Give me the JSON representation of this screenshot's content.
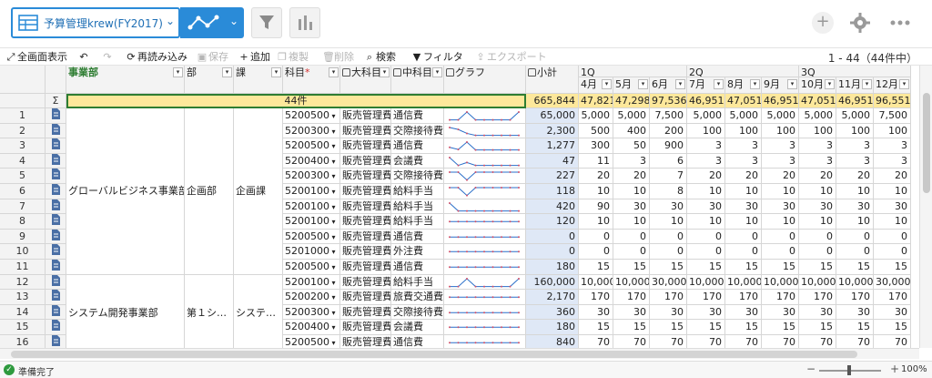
{
  "app": {
    "view_title": "予算管理krew(FY2017)",
    "record_range": "1 - 44（44件中）",
    "status": "準備完了",
    "zoom": "100%",
    "accent": "#2a8bd8"
  },
  "toolbar": [
    {
      "icon": "expand-icon",
      "label": "全画面表示",
      "enabled": true
    },
    {
      "icon": "undo-icon",
      "label": "",
      "enabled": true
    },
    {
      "icon": "redo-icon",
      "label": "",
      "enabled": false
    },
    {
      "icon": "reload-icon",
      "label": "再読み込み",
      "enabled": true
    },
    {
      "icon": "save-icon",
      "label": "保存",
      "enabled": false
    },
    {
      "icon": "plus-icon",
      "label": "追加",
      "enabled": true
    },
    {
      "icon": "copy-icon",
      "label": "複製",
      "enabled": false
    },
    {
      "icon": "trash-icon",
      "label": "削除",
      "enabled": false
    },
    {
      "icon": "search-icon",
      "label": "検索",
      "enabled": true
    },
    {
      "icon": "filter-icon",
      "label": "フィルタ",
      "enabled": true
    },
    {
      "icon": "export-icon",
      "label": "エクスポート",
      "enabled": false
    }
  ],
  "columns": {
    "division": "事業部",
    "department": "部",
    "section": "課",
    "account": "科目",
    "account_required": "*",
    "major": "大科目",
    "minor": "中科目",
    "graph": "グラフ",
    "subtotal": "小計",
    "quarters": [
      "1Q",
      "2Q",
      "3Q"
    ],
    "months": [
      "4月",
      "5月",
      "6月",
      "7月",
      "8月",
      "9月",
      "10月",
      "11月",
      "12月"
    ]
  },
  "summary": {
    "symbol": "Σ",
    "count": "44件",
    "subtotal": "665,844",
    "months": [
      "47,821",
      "47,298",
      "97,536",
      "46,951",
      "47,051",
      "46,951",
      "47,051",
      "46,951",
      "96,551"
    ]
  },
  "groups": [
    {
      "division": "グローバルビジネス事業部",
      "department": "企画部",
      "section": "企画課",
      "rows": 11
    },
    {
      "division": "システム開発事業部",
      "department": "第１シ…",
      "section": "システ…",
      "rows": 5
    }
  ],
  "rows": [
    {
      "n": "1",
      "code": "5200500",
      "major": "販売管理費",
      "minor": "通信費",
      "subtotal": "65,000",
      "m": [
        "5,000",
        "5,000",
        "7,500",
        "5,000",
        "5,000",
        "5,000",
        "5,000",
        "5,000",
        "7,500"
      ],
      "spark": [
        5,
        5,
        7.5,
        5,
        5,
        5,
        5,
        5,
        7.5
      ]
    },
    {
      "n": "2",
      "code": "5200300",
      "major": "販売管理費",
      "minor": "交際接待費",
      "subtotal": "2,300",
      "m": [
        "500",
        "400",
        "200",
        "100",
        "100",
        "100",
        "100",
        "100",
        "100"
      ],
      "spark": [
        5,
        4,
        2,
        1,
        1,
        1,
        1,
        1,
        1
      ]
    },
    {
      "n": "3",
      "code": "5200500",
      "major": "販売管理費",
      "minor": "通信費",
      "subtotal": "1,277",
      "m": [
        "300",
        "50",
        "900",
        "3",
        "3",
        "3",
        "3",
        "3",
        "3"
      ],
      "spark": [
        3,
        0.5,
        9,
        0,
        0,
        0,
        0,
        0,
        0
      ]
    },
    {
      "n": "4",
      "code": "5200400",
      "major": "販売管理費",
      "minor": "会議費",
      "subtotal": "47",
      "m": [
        "11",
        "3",
        "6",
        "3",
        "3",
        "3",
        "3",
        "3",
        "3"
      ],
      "spark": [
        11,
        3,
        6,
        3,
        3,
        3,
        3,
        3,
        3
      ]
    },
    {
      "n": "5",
      "code": "5200300",
      "major": "販売管理費",
      "minor": "交際接待費",
      "subtotal": "227",
      "m": [
        "20",
        "20",
        "7",
        "20",
        "20",
        "20",
        "20",
        "20",
        "20"
      ],
      "spark": [
        20,
        20,
        7,
        20,
        20,
        20,
        20,
        20,
        20
      ]
    },
    {
      "n": "6",
      "code": "5200100",
      "major": "販売管理費",
      "minor": "給料手当",
      "subtotal": "118",
      "m": [
        "10",
        "10",
        "8",
        "10",
        "10",
        "10",
        "10",
        "10",
        "10"
      ],
      "spark": [
        10,
        10,
        8,
        10,
        10,
        10,
        10,
        10,
        10
      ]
    },
    {
      "n": "7",
      "code": "5200100",
      "major": "販売管理費",
      "minor": "給料手当",
      "subtotal": "420",
      "m": [
        "90",
        "30",
        "30",
        "30",
        "30",
        "30",
        "30",
        "30",
        "30"
      ],
      "spark": [
        90,
        30,
        30,
        30,
        30,
        30,
        30,
        30,
        30
      ]
    },
    {
      "n": "8",
      "code": "5200100",
      "major": "販売管理費",
      "minor": "給料手当",
      "subtotal": "120",
      "m": [
        "10",
        "10",
        "10",
        "10",
        "10",
        "10",
        "10",
        "10",
        "10"
      ],
      "spark": [
        10,
        10,
        10,
        10,
        10,
        10,
        10,
        10,
        10
      ]
    },
    {
      "n": "9",
      "code": "5200500",
      "major": "販売管理費",
      "minor": "通信費",
      "subtotal": "0",
      "m": [
        "0",
        "0",
        "0",
        "0",
        "0",
        "0",
        "0",
        "0",
        "0"
      ],
      "spark": [
        0,
        0,
        0,
        0,
        0,
        0,
        0,
        0,
        0
      ]
    },
    {
      "n": "10",
      "code": "5201000",
      "major": "販売管理費",
      "minor": "外注費",
      "subtotal": "0",
      "m": [
        "0",
        "0",
        "0",
        "0",
        "0",
        "0",
        "0",
        "0",
        "0"
      ],
      "spark": [
        0,
        0,
        0,
        0,
        0,
        0,
        0,
        0,
        0
      ]
    },
    {
      "n": "11",
      "code": "5200500",
      "major": "販売管理費",
      "minor": "通信費",
      "subtotal": "180",
      "m": [
        "15",
        "15",
        "15",
        "15",
        "15",
        "15",
        "15",
        "15",
        "15"
      ],
      "spark": [
        15,
        15,
        15,
        15,
        15,
        15,
        15,
        15,
        15
      ]
    },
    {
      "n": "12",
      "code": "5200100",
      "major": "販売管理費",
      "minor": "給料手当",
      "subtotal": "160,000",
      "m": [
        "10,000",
        "10,000",
        "30,000",
        "10,000",
        "10,000",
        "10,000",
        "10,000",
        "10,000",
        "30,000"
      ],
      "spark": [
        10,
        10,
        30,
        10,
        10,
        10,
        10,
        10,
        30
      ]
    },
    {
      "n": "13",
      "code": "5200200",
      "major": "販売管理費",
      "minor": "旅費交通費",
      "subtotal": "2,170",
      "m": [
        "170",
        "170",
        "170",
        "170",
        "170",
        "170",
        "170",
        "170",
        "170"
      ],
      "spark": [
        170,
        170,
        170,
        170,
        170,
        170,
        170,
        170,
        170
      ]
    },
    {
      "n": "14",
      "code": "5200300",
      "major": "販売管理費",
      "minor": "交際接待費",
      "subtotal": "360",
      "m": [
        "30",
        "30",
        "30",
        "30",
        "30",
        "30",
        "30",
        "30",
        "30"
      ],
      "spark": [
        30,
        30,
        30,
        30,
        30,
        30,
        30,
        30,
        30
      ]
    },
    {
      "n": "15",
      "code": "5200400",
      "major": "販売管理費",
      "minor": "会議費",
      "subtotal": "180",
      "m": [
        "15",
        "15",
        "15",
        "15",
        "15",
        "15",
        "15",
        "15",
        "15"
      ],
      "spark": [
        15,
        15,
        15,
        15,
        15,
        15,
        15,
        15,
        15
      ]
    },
    {
      "n": "16",
      "code": "5200500",
      "major": "販売管理費",
      "minor": "通信費",
      "subtotal": "840",
      "m": [
        "70",
        "70",
        "70",
        "70",
        "70",
        "70",
        "70",
        "70",
        "70"
      ],
      "spark": [
        70,
        70,
        70,
        70,
        70,
        70,
        70,
        70,
        70
      ]
    }
  ]
}
